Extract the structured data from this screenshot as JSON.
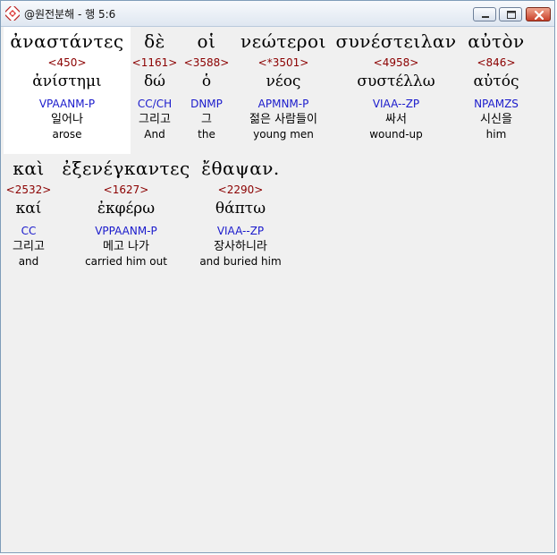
{
  "window": {
    "title": "@원전분해 - 행 5:6"
  },
  "verse_words": [
    {
      "greek": "ἀναστάντες",
      "strong": "<450>",
      "lemma": "ἀνίστημι",
      "parse": "VPAANM-P",
      "korean": "일어나",
      "english": "arose"
    },
    {
      "greek": "δὲ",
      "strong": "<1161>",
      "lemma": "δώ",
      "parse": "CC/CH",
      "korean": "그리고",
      "english": "And"
    },
    {
      "greek": "οἱ",
      "strong": "<3588>",
      "lemma": "ὁ",
      "parse": "DNMP",
      "korean": "그",
      "english": "the"
    },
    {
      "greek": "νεώτεροι",
      "strong": "<*3501>",
      "lemma": "νέος",
      "parse": "APMNM-P",
      "korean": "젊은 사람들이",
      "english": "young men"
    },
    {
      "greek": "συνέστειλαν",
      "strong": "<4958>",
      "lemma": "συστέλλω",
      "parse": "VIAA--ZP",
      "korean": "싸서",
      "english": "wound-up"
    },
    {
      "greek": "αὐτὸν",
      "strong": "<846>",
      "lemma": "αὐτός",
      "parse": "NPAMZS",
      "korean": "시신을",
      "english": "him"
    },
    {
      "greek": "καὶ",
      "strong": "<2532>",
      "lemma": "καί",
      "parse": "CC",
      "korean": "그리고",
      "english": "and"
    },
    {
      "greek": "ἐξενέγκαντες",
      "strong": "<1627>",
      "lemma": "ἐκφέρω",
      "parse": "VPPAANM-P",
      "korean": "메고 나가",
      "english": "carried him out"
    },
    {
      "greek": "ἔθαψαν.",
      "strong": "<2290>",
      "lemma": "θάπτω",
      "parse": "VIAA--ZP",
      "korean": "장사하니라",
      "english": "and buried him"
    }
  ]
}
